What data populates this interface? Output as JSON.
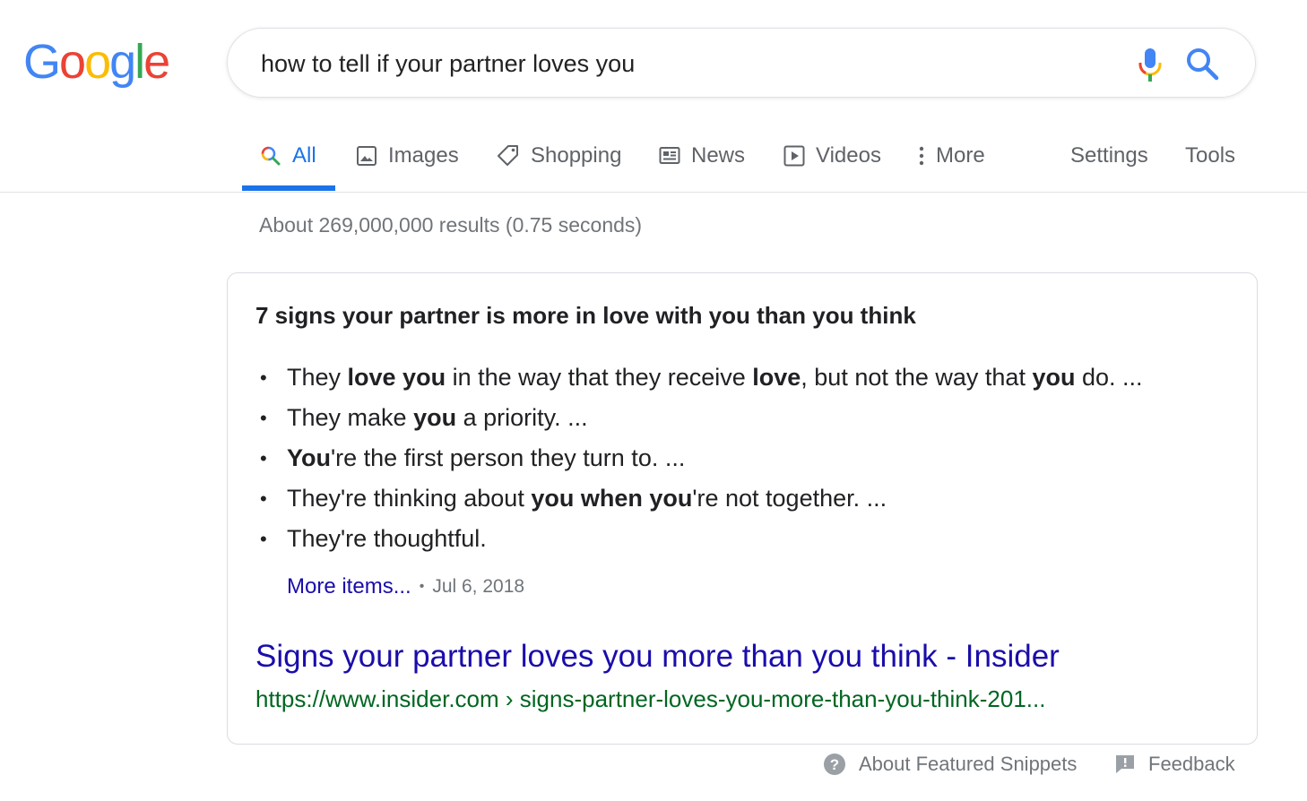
{
  "logo": {
    "letters": [
      "G",
      "o",
      "o",
      "g",
      "l",
      "e"
    ],
    "colors": [
      "#4285f4",
      "#ea4335",
      "#fbbc05",
      "#4285f4",
      "#34a853",
      "#ea4335"
    ]
  },
  "search": {
    "query": "how to tell if your partner loves you"
  },
  "tabs": [
    {
      "label": "All",
      "icon": "search-icon",
      "active": true
    },
    {
      "label": "Images",
      "icon": "image-icon"
    },
    {
      "label": "Shopping",
      "icon": "tag-icon"
    },
    {
      "label": "News",
      "icon": "news-icon"
    },
    {
      "label": "Videos",
      "icon": "play-icon"
    },
    {
      "label": "More",
      "icon": "dots-vertical-icon"
    }
  ],
  "tools": {
    "settings": "Settings",
    "tools": "Tools"
  },
  "stats": "About 269,000,000 results (0.75 seconds)",
  "snippet": {
    "title": "7 signs your partner is more in love with you than you think",
    "items": [
      [
        {
          "t": "They "
        },
        {
          "t": "love you",
          "b": true
        },
        {
          "t": " in the way that they receive "
        },
        {
          "t": "love",
          "b": true
        },
        {
          "t": ", but not the way that "
        },
        {
          "t": "you",
          "b": true
        },
        {
          "t": " do. ..."
        }
      ],
      [
        {
          "t": "They make "
        },
        {
          "t": "you",
          "b": true
        },
        {
          "t": " a priority. ..."
        }
      ],
      [
        {
          "t": "You",
          "b": true
        },
        {
          "t": "'re the first person they turn to. ..."
        }
      ],
      [
        {
          "t": "They're thinking about "
        },
        {
          "t": "you when you",
          "b": true
        },
        {
          "t": "'re not together. ..."
        }
      ],
      [
        {
          "t": "They're thoughtful."
        }
      ]
    ],
    "more_items": "More items...",
    "date": "Jul 6, 2018",
    "result_title": "Signs your partner loves you more than you think - Insider",
    "result_url": "https://www.insider.com › signs-partner-loves-you-more-than-you-think-201..."
  },
  "footer": {
    "about": "About Featured Snippets",
    "feedback": "Feedback"
  },
  "colors": {
    "accent": "#1a73e8",
    "link": "#1a0dab",
    "url_green": "#006621"
  }
}
